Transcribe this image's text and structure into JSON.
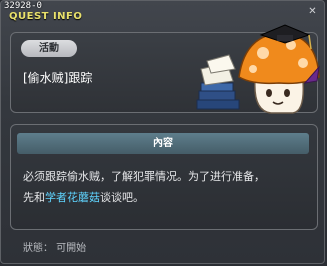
{
  "window": {
    "quest_id": "32928-0",
    "title": "QUEST INFO",
    "close_glyph": "✕"
  },
  "header": {
    "category_label": "活動",
    "quest_name": "[偷水贼]跟踪"
  },
  "content": {
    "section_title": "內容",
    "text_line1": "必须跟踪偷水贼，了解犯罪情况。为了进行准备，",
    "text_line2_prefix": "先和",
    "npc_name": "学者花蘑菇",
    "text_line2_suffix": "谈谈吧。",
    "npc_color": "#5fd4ff"
  },
  "status": {
    "text": "狀態： 可開始"
  },
  "icons": [
    "close-icon",
    "mushroom-scholar-illustration"
  ]
}
